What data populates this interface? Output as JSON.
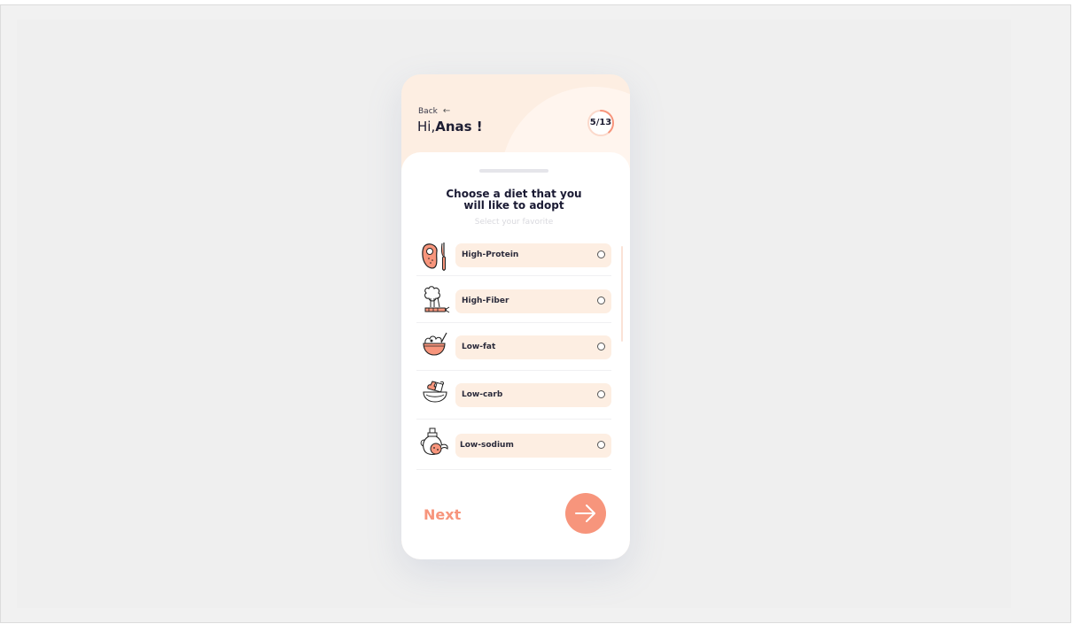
{
  "header": {
    "back_label": "Back",
    "greeting_prefix": "Hi,",
    "user_name": "Anas !",
    "progress_text": "5/13",
    "progress_fraction": 0.3846
  },
  "question": {
    "title_line1": "Choose a diet that you",
    "title_line2": "will like to adopt",
    "subtitle": "Select your favorite"
  },
  "options": [
    {
      "label": "High-Protein",
      "icon": "steak-knife-icon",
      "selected": false
    },
    {
      "label": "High-Fiber",
      "icon": "vegetables-icon",
      "selected": false
    },
    {
      "label": "Low-fat",
      "icon": "salad-bowl-icon",
      "selected": false
    },
    {
      "label": "Low-carb",
      "icon": "food-bowl-icon",
      "selected": false
    },
    {
      "label": "Low-sodium",
      "icon": "oil-jar-icon",
      "selected": false
    }
  ],
  "footer": {
    "next_label": "Next"
  },
  "colors": {
    "accent": "#f7957c",
    "pill_bg": "#fdeee2",
    "text_dark": "#1e1e33"
  }
}
